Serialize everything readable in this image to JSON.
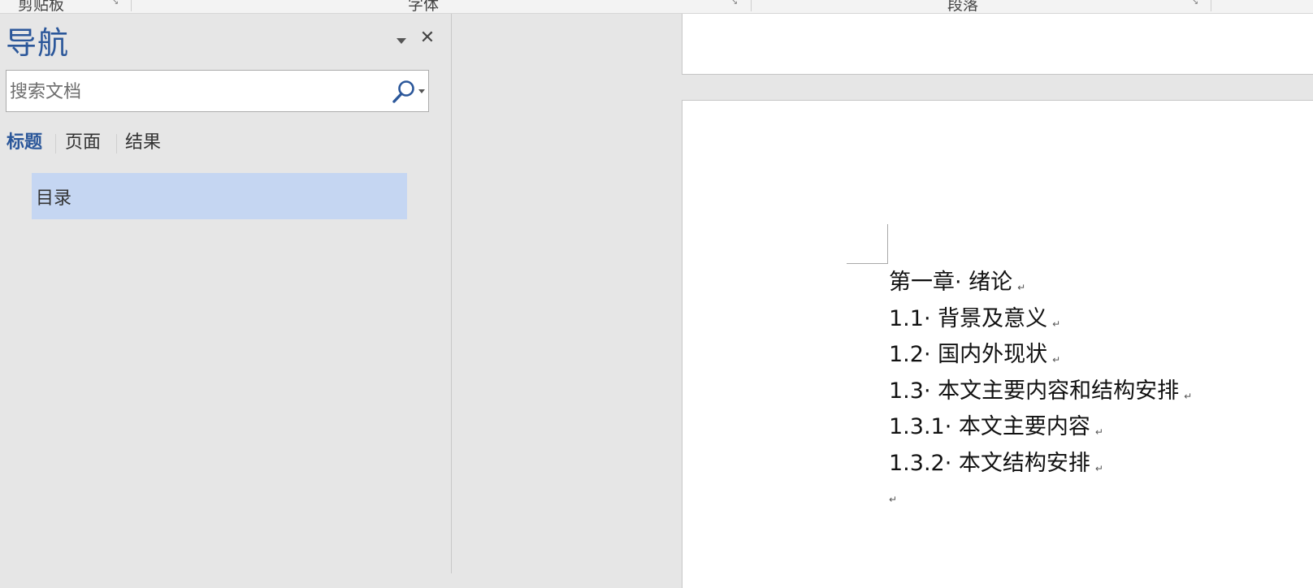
{
  "ribbon": {
    "groups": [
      {
        "label": "剪贴板"
      },
      {
        "label": "字体"
      },
      {
        "label": "段落"
      }
    ]
  },
  "nav_pane": {
    "title": "导航",
    "search_placeholder": "搜索文档",
    "tabs": [
      {
        "label": "标题",
        "active": true
      },
      {
        "label": "页面",
        "active": false
      },
      {
        "label": "结果",
        "active": false
      }
    ],
    "headings": [
      {
        "label": "目录",
        "selected": true
      }
    ],
    "close_glyph": "✕"
  },
  "document": {
    "paragraph_mark": "↵",
    "toc_lines": [
      {
        "text": "第一章· 绪论"
      },
      {
        "text": "1.1· 背景及意义"
      },
      {
        "text": "1.2· 国内外现状"
      },
      {
        "text": "1.3· 本文主要内容和结构安排"
      },
      {
        "text": "1.3.1· 本文主要内容"
      },
      {
        "text": "1.3.2· 本文结构安排"
      }
    ]
  },
  "colors": {
    "accent": "#2b579a",
    "selected_heading_bg": "#c5d6f2",
    "pane_bg": "#e6e6e6"
  }
}
